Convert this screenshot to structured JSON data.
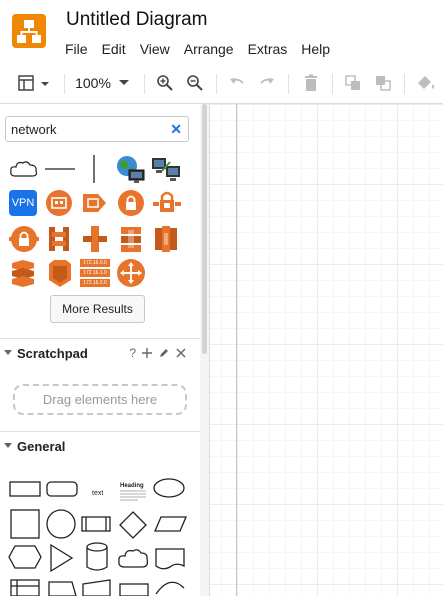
{
  "app": {
    "title": "Untitled Diagram",
    "logo": "drawio-logo",
    "accent_color": "#f08705"
  },
  "menu": [
    "File",
    "Edit",
    "View",
    "Arrange",
    "Extras",
    "Help"
  ],
  "toolbar": {
    "zoom": "100%",
    "icons": [
      "format-panel-icon",
      "chevron-down-icon",
      "zoom-in-icon",
      "zoom-out-icon",
      "undo-icon",
      "redo-icon",
      "delete-icon",
      "to-front-icon",
      "to-back-icon",
      "fill-color-icon"
    ]
  },
  "sidebar": {
    "search": {
      "value": "network",
      "placeholder": ""
    },
    "search_results": {
      "icons": [
        "cloud-shape",
        "line-shape",
        "vertical-line-shape",
        "globe-network-icon",
        "computers-network-icon",
        "vpn-icon",
        "aws-router-icon",
        "aws-arrow-icon",
        "aws-lock-icon",
        "aws-gateway-icon",
        "aws-lock-circle-icon",
        "aws-vpc-icon",
        "aws-direct-connect-icon",
        "aws-route-icon",
        "aws-stack-icon",
        "aws-layers-icon",
        "aws-shield-icon",
        "aws-subnets-icon",
        "aws-directions-icon"
      ],
      "vpn_label": "VPN",
      "subnets": [
        "172.16.0.0",
        "172.16.1.0",
        "172.16.2.0"
      ],
      "more_results": "More Results"
    },
    "scratchpad": {
      "title": "Scratchpad",
      "actions": [
        "help-icon",
        "add-icon",
        "edit-icon",
        "close-icon"
      ],
      "help_glyph": "?",
      "dropzone": "Drag elements here"
    },
    "general": {
      "title": "General",
      "text_shape": "text",
      "heading_shape": "Heading"
    },
    "colors": {
      "vpn_blue": "#1a73e8",
      "aws_orange": "#e8742c"
    }
  }
}
